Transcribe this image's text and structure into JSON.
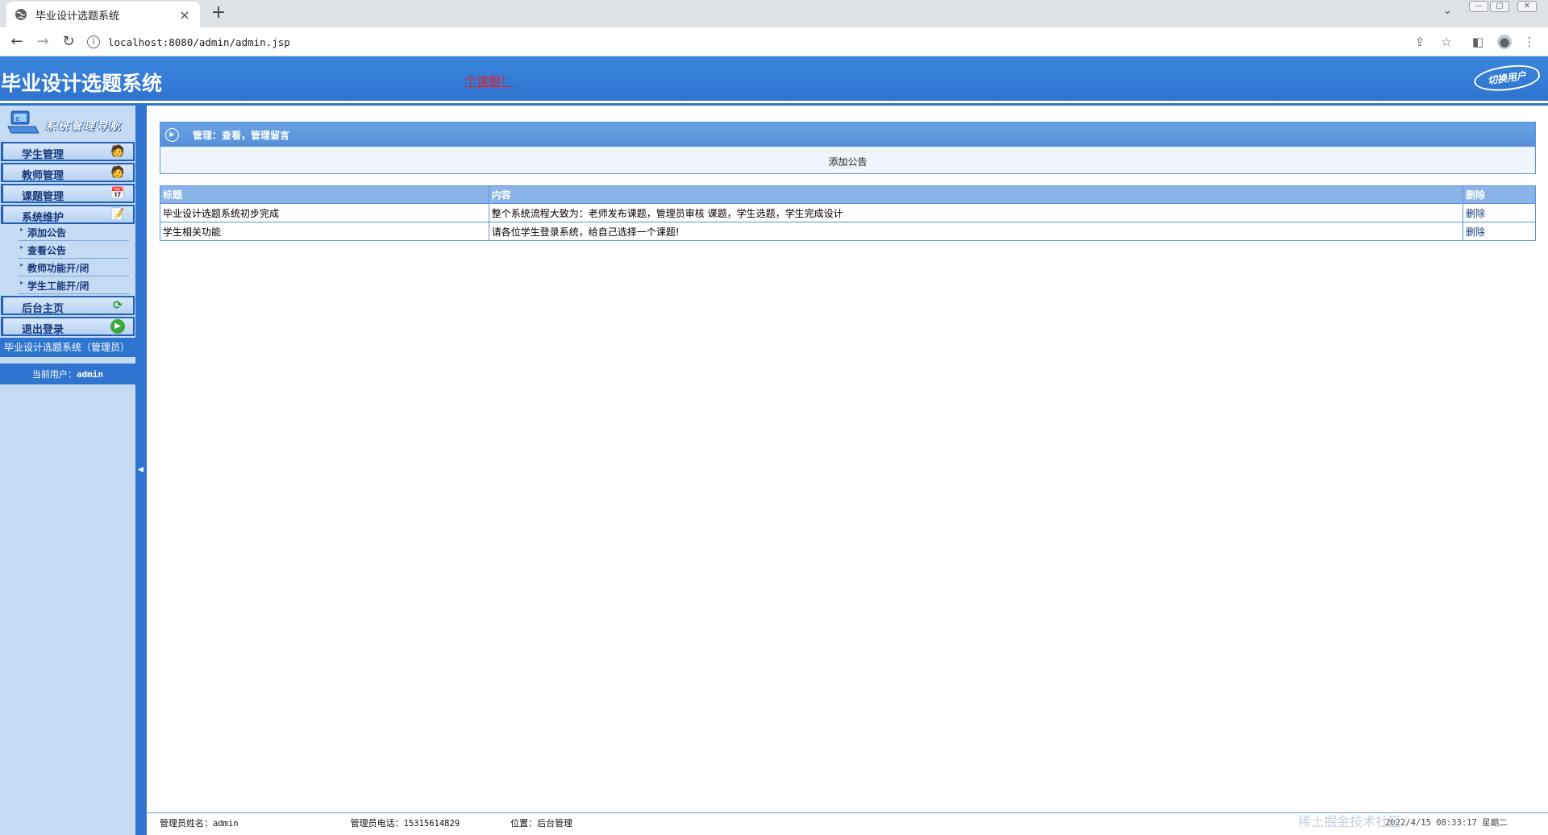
{
  "browser": {
    "tab_title": "毕业设计选题系统",
    "tab_close": "×",
    "new_tab": "+",
    "tab_list": "⌄",
    "url": "localhost:8080/admin/admin.jsp",
    "win_min": "—",
    "win_max": "▢",
    "win_close": "✕"
  },
  "header": {
    "title": "毕业设计选题系统",
    "marquee": "个课题！",
    "switch_user": "切换用户"
  },
  "sidebar": {
    "nav_title": "系统管理导航",
    "menu": [
      {
        "label": "学生管理"
      },
      {
        "label": "教师管理"
      },
      {
        "label": "课题管理"
      },
      {
        "label": "系统维护"
      }
    ],
    "submenu": [
      {
        "label": "添加公告"
      },
      {
        "label": "查看公告"
      },
      {
        "label": "教师功能开/闭"
      },
      {
        "label": "学生工能开/闭"
      }
    ],
    "bottom_menu": [
      {
        "label": "后台主页"
      },
      {
        "label": "退出登录"
      }
    ],
    "system_caption": "毕业设计选题系统（管理员）",
    "current_user_label": "当前用户：",
    "current_user": "admin"
  },
  "main": {
    "panel_title": "管理：查看，管理留言",
    "add_notice": "添加公告",
    "table": {
      "headers": [
        "标题",
        "内容",
        "删除"
      ],
      "rows": [
        {
          "title": "毕业设计选题系统初步完成",
          "content": "整个系统流程大致为：老师发布课题，管理员审核 课题，学生选题，学生完成设计",
          "delete": "删除"
        },
        {
          "title": "学生相关功能",
          "content": "请各位学生登录系统，给自己选择一个课题!",
          "delete": "删除"
        }
      ]
    }
  },
  "footer": {
    "admin_name_label": "管理员姓名：",
    "admin_name": "admin",
    "admin_phone_label": "管理员电话：",
    "admin_phone": "15315614829",
    "location_label": "位置：",
    "location": "后台管理",
    "datetime": "2022/4/15 08:33:17 星期二",
    "watermark": "稀土掘金技术社区"
  },
  "colors": {
    "header_blue": "#2f74cf",
    "sidebar_bg": "#c5dbf3",
    "table_header": "#8ab4e8",
    "marquee_red": "#e0202a"
  }
}
